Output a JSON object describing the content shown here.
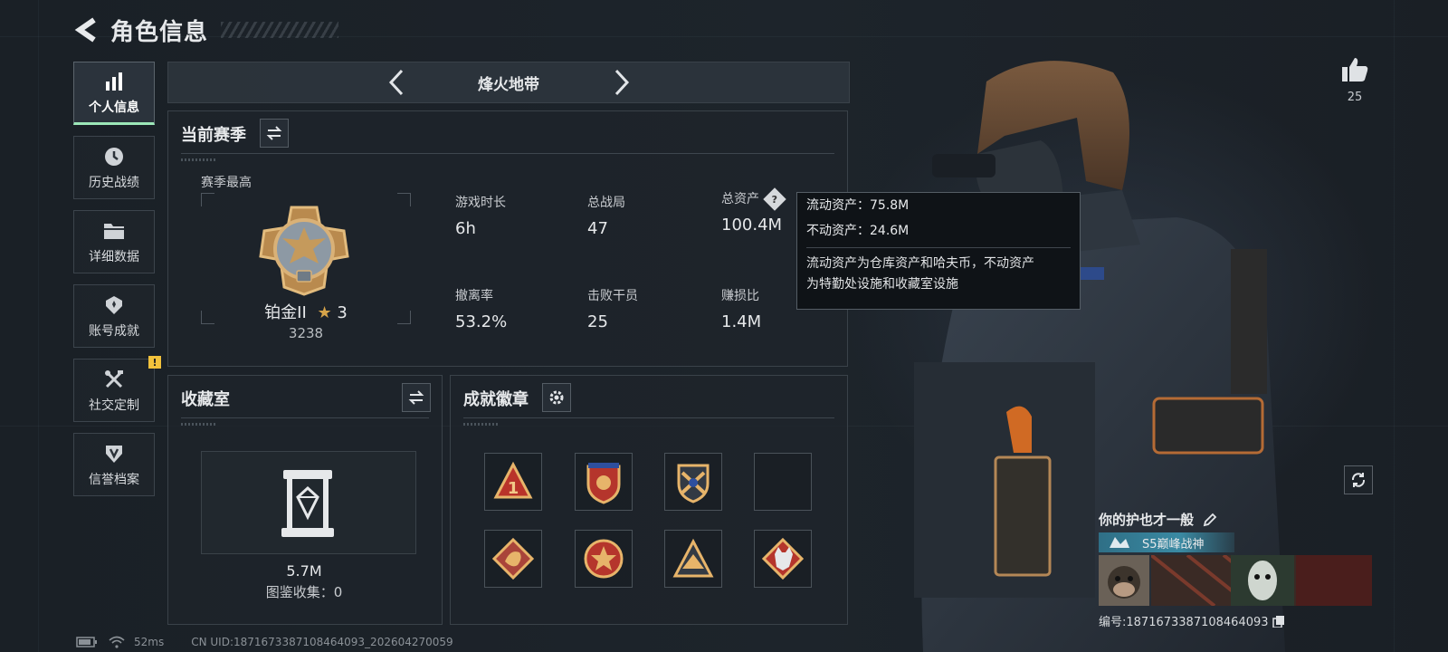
{
  "header": {
    "title": "角色信息"
  },
  "sidebar": {
    "items": [
      {
        "label": "个人信息",
        "icon": "bar-chart-icon",
        "active": true
      },
      {
        "label": "历史战绩",
        "icon": "clock-icon"
      },
      {
        "label": "详细数据",
        "icon": "folder-icon"
      },
      {
        "label": "账号成就",
        "icon": "trophy-icon"
      },
      {
        "label": "社交定制",
        "icon": "tools-icon",
        "badge": "!"
      },
      {
        "label": "信誉档案",
        "icon": "shield-icon"
      }
    ]
  },
  "mode": {
    "title": "烽火地带"
  },
  "season": {
    "title": "当前赛季",
    "subtitle": "赛季最高",
    "rank_name": "铂金II",
    "rank_stars": "3",
    "rank_score": "3238",
    "stats": [
      {
        "label": "游戏时长",
        "value": "6h"
      },
      {
        "label": "总战局",
        "value": "47"
      },
      {
        "label": "总资产",
        "value": "100.4M"
      },
      {
        "label": "撤离率",
        "value": "53.2%"
      },
      {
        "label": "击败干员",
        "value": "25"
      },
      {
        "label": "赚损比",
        "value": "1.4M"
      }
    ]
  },
  "tooltip": {
    "liquid": "流动资产：75.8M",
    "fixed": "不动资产：24.6M",
    "desc_line1": "流动资产为仓库资产和哈夫币，不动资产",
    "desc_line2": "为特勤处设施和收藏室设施"
  },
  "collection": {
    "title": "收藏室",
    "value": "5.7M",
    "count": "图鉴收集：0"
  },
  "badges": {
    "title": "成就徽章"
  },
  "likes": {
    "count": "25"
  },
  "player": {
    "name": "你的护也才一般",
    "title": "S5巅峰战神",
    "uid": "编号:1871673387108464093"
  },
  "status_bar": {
    "ping": "52ms",
    "uid_line": "CN UID:1871673387108464093_202604270059"
  },
  "colors": {
    "accent_green": "#9ce7b8",
    "warning": "#f2c23c",
    "gold": "#d6a44a"
  }
}
